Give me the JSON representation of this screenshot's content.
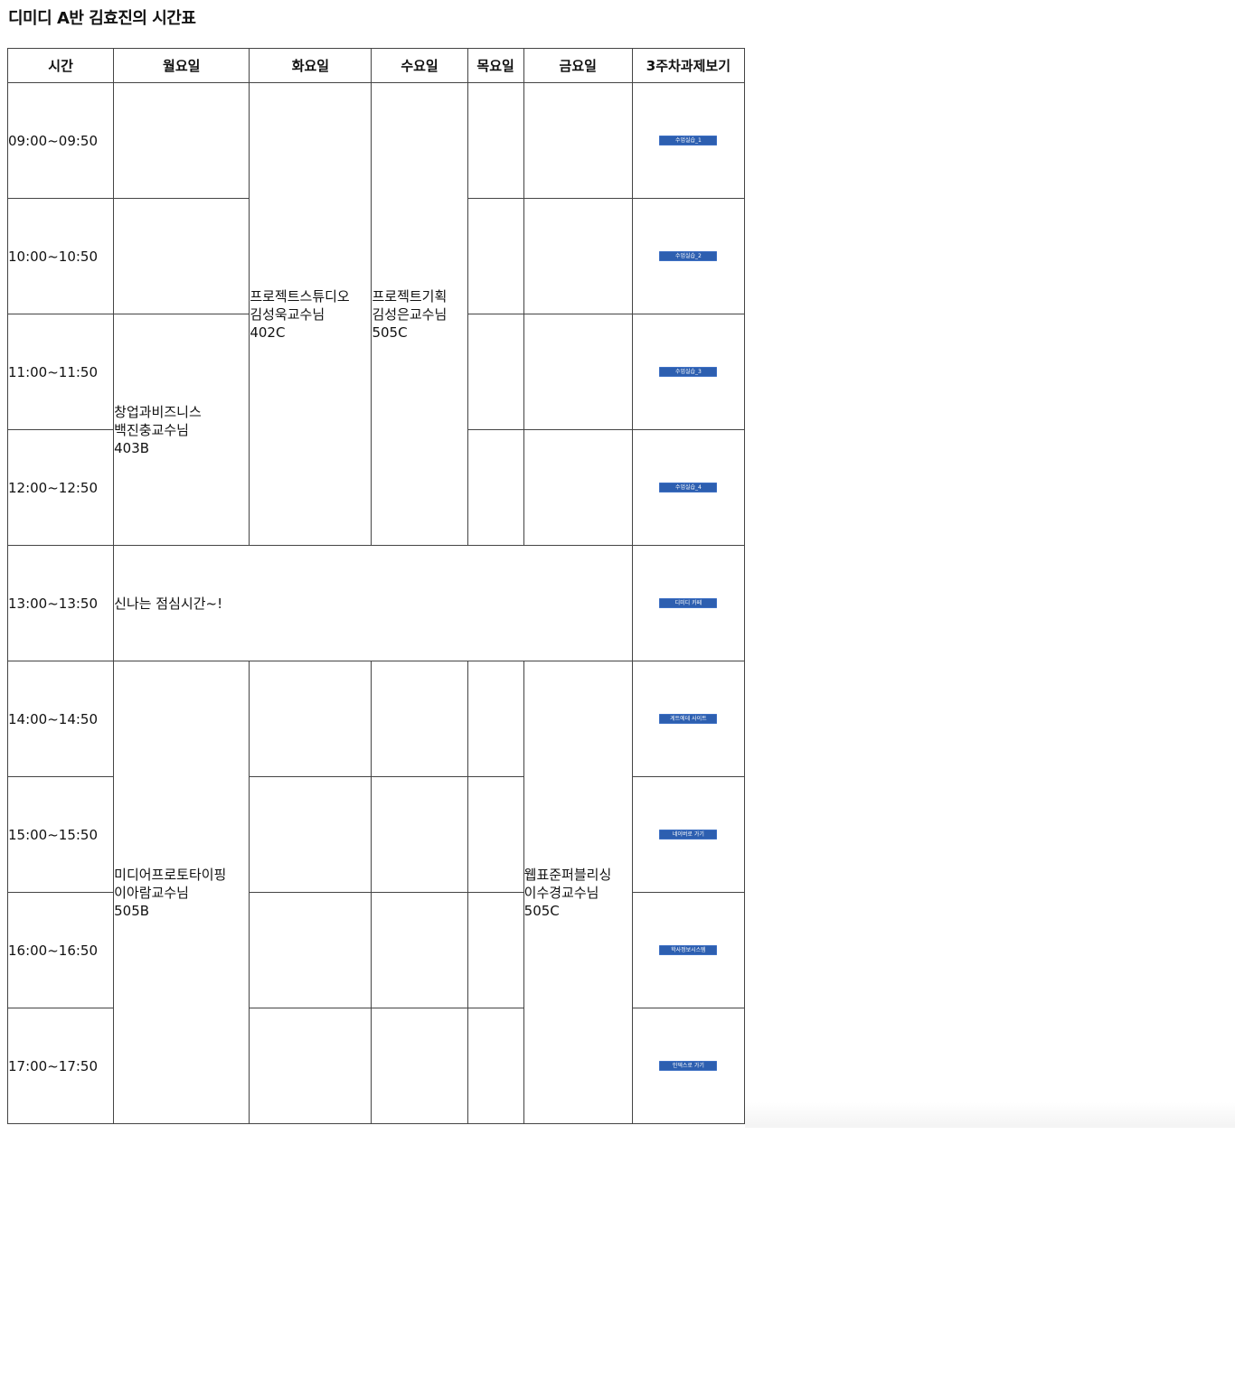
{
  "page": {
    "title": "디미디 A반 김효진의 시간표"
  },
  "table": {
    "headers": [
      "시간",
      "월요일",
      "화요일",
      "수요일",
      "목요일",
      "금요일",
      "3주차과제보기"
    ],
    "times": [
      "09:00~09:50",
      "10:00~10:50",
      "11:00~11:50",
      "12:00~12:50",
      "13:00~13:50",
      "14:00~14:50",
      "15:00~15:50",
      "16:00~16:50",
      "17:00~17:50"
    ],
    "classes": {
      "tue_project_studio": [
        "프로젝트스튜디오",
        "김성욱교수님",
        "402C"
      ],
      "wed_project_planning": [
        "프로젝트기획",
        "김성은교수님",
        "505C"
      ],
      "mon_startup": [
        "창업과비즈니스",
        "백진충교수님",
        "403B"
      ],
      "mon_media": [
        "미디어프로토타이핑",
        "이아람교수님",
        "505B"
      ],
      "fri_web": [
        "웹표준퍼블리싱",
        "이수경교수님",
        "505C"
      ]
    },
    "lunch": "신나는 점심시간~!",
    "links": [
      "수업실습_1",
      "수업실습_2",
      "수업실습_3",
      "수업실습_4",
      "디미디 카페",
      "게트에데 사이트",
      "네이버로 가기",
      "학사정보시스템",
      "인덱스로 가기"
    ]
  }
}
